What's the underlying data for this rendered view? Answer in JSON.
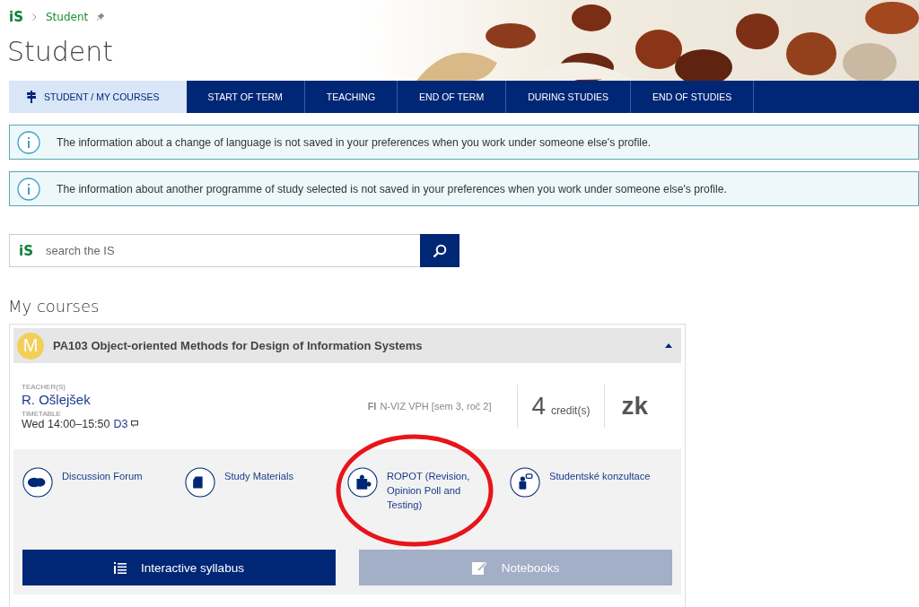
{
  "breadcrumb": {
    "logo": "iS",
    "items": [
      "Student"
    ]
  },
  "title": "Student",
  "tabs": [
    {
      "label": "STUDENT / MY COURSES",
      "selected": true
    },
    {
      "label": "START OF TERM",
      "selected": false
    },
    {
      "label": "TEACHING",
      "selected": false
    },
    {
      "label": "END OF TERM",
      "selected": false
    },
    {
      "label": "DURING STUDIES",
      "selected": false
    },
    {
      "label": "END OF STUDIES",
      "selected": false
    }
  ],
  "notices": [
    "The information about a change of language is not saved in your preferences when you work under someone else's profile.",
    "The information about another programme of study selected is not saved in your preferences when you work under someone else's profile."
  ],
  "search": {
    "logo": "iS",
    "placeholder": "search the IS"
  },
  "section_heading": "My courses",
  "course": {
    "badge": "M",
    "title": "PA103 Object-oriented Methods for Design of Information Systems",
    "expanded": true,
    "teacher_label": "TEACHER(S)",
    "teacher": "R. Ošlejšek",
    "timetable_label": "TIMETABLE",
    "timetable": "Wed 14:00–15:50",
    "room": "D3",
    "faculty": "FI",
    "programme": "N-VIZ VPH [sem 3, roč 2]",
    "credits": "4",
    "credits_label": "credit(s)",
    "completion": "zk",
    "links": [
      {
        "kind": "forum",
        "label": "Discussion Forum"
      },
      {
        "kind": "materials",
        "label": "Study Materials"
      },
      {
        "kind": "ropot",
        "label": "ROPOT (Revision, Opinion Poll and Testing)"
      },
      {
        "kind": "consult",
        "label": "Studentské konzultace"
      }
    ],
    "buttons": [
      {
        "kind": "syllabus",
        "label": "Interactive syllabus",
        "disabled": false
      },
      {
        "kind": "notebooks",
        "label": "Notebooks",
        "disabled": true
      }
    ]
  },
  "annotations": [
    {
      "kind": "ellipse"
    }
  ]
}
